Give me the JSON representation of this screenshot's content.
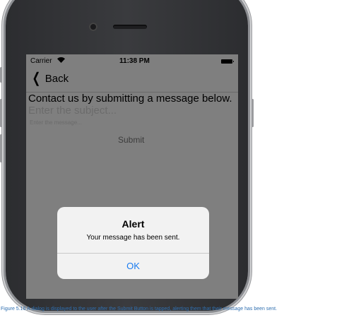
{
  "status_bar": {
    "carrier": "Carrier",
    "time": "11:38 PM"
  },
  "nav": {
    "back_label": "Back"
  },
  "form": {
    "heading": "Contact us by submitting a message below.",
    "subject_placeholder": "Enter the subject...",
    "message_placeholder": "Enter the message...",
    "submit_label": "Submit"
  },
  "alert": {
    "title": "Alert",
    "message": "Your message has been sent.",
    "ok_label": "OK"
  },
  "caption": "Figure 5.16 A dialog is displayed to the user after the Submit Button is tapped, alerting them that their message has been sent.",
  "colors": {
    "dim_overlay": "#7f7f7f",
    "alert_bg": "#f2f2f2",
    "ok_link": "#1a7cf0",
    "caption": "#2f6fb0"
  }
}
